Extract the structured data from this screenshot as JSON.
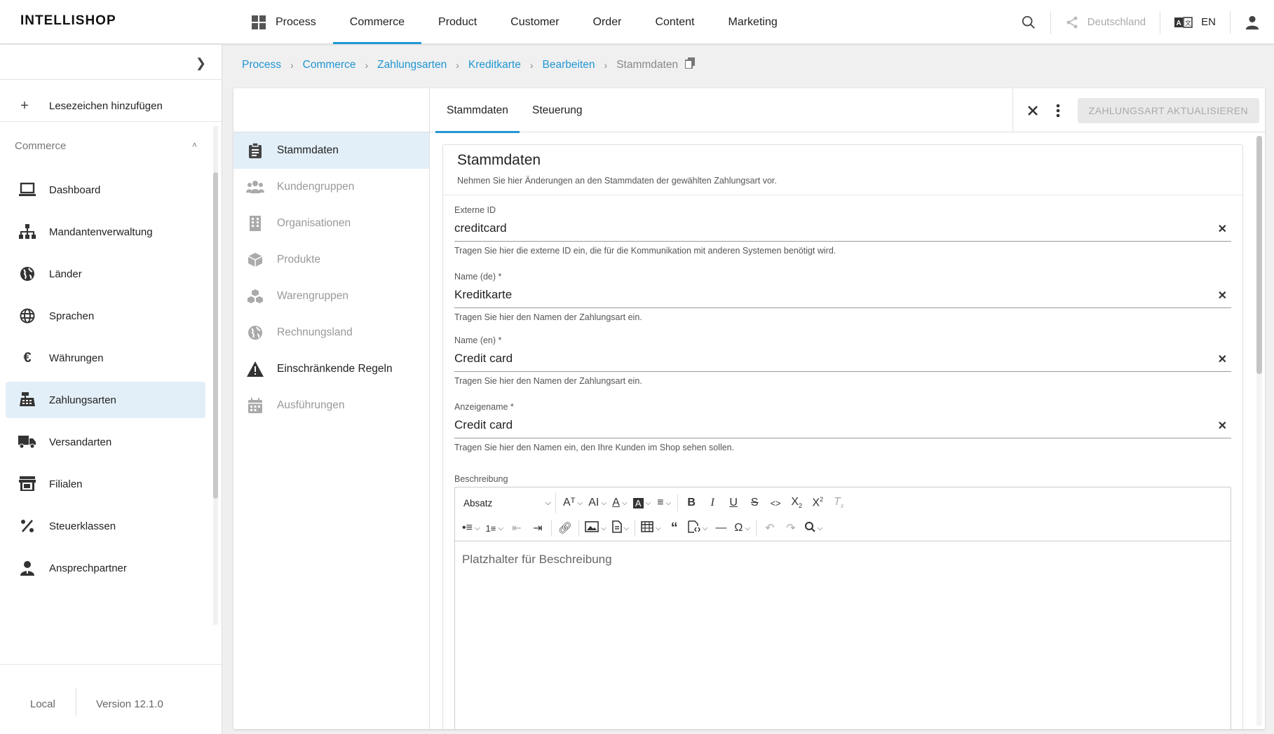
{
  "app": {
    "logo": "INTELLISHOP"
  },
  "topnav": {
    "items": [
      "Process",
      "Commerce",
      "Product",
      "Customer",
      "Order",
      "Content",
      "Marketing"
    ],
    "active": "Commerce",
    "country": "Deutschland",
    "language": "EN"
  },
  "sidebar": {
    "bookmark_label": "Lesezeichen hinzufügen",
    "section": "Commerce",
    "items": [
      {
        "label": "Dashboard",
        "icon": "laptop-icon"
      },
      {
        "label": "Mandantenverwaltung",
        "icon": "hierarchy-icon"
      },
      {
        "label": "Länder",
        "icon": "globe-icon"
      },
      {
        "label": "Sprachen",
        "icon": "language-globe-icon"
      },
      {
        "label": "Währungen",
        "icon": "euro-icon"
      },
      {
        "label": "Zahlungsarten",
        "icon": "cash-register-icon",
        "active": true
      },
      {
        "label": "Versandarten",
        "icon": "truck-icon"
      },
      {
        "label": "Filialen",
        "icon": "store-icon"
      },
      {
        "label": "Steuerklassen",
        "icon": "percent-icon"
      },
      {
        "label": "Ansprechpartner",
        "icon": "person-icon"
      }
    ],
    "footer": {
      "env": "Local",
      "version": "Version 12.1.0"
    }
  },
  "breadcrumb": {
    "items": [
      "Process",
      "Commerce",
      "Zahlungsarten",
      "Kreditkarte",
      "Bearbeiten"
    ],
    "current": "Stammdaten"
  },
  "left_nav": {
    "items": [
      {
        "label": "Stammdaten",
        "icon": "clipboard-icon",
        "state": "active"
      },
      {
        "label": "Kundengruppen",
        "icon": "users-icon",
        "state": "disabled"
      },
      {
        "label": "Organisationen",
        "icon": "building-icon",
        "state": "disabled"
      },
      {
        "label": "Produkte",
        "icon": "box-icon",
        "state": "disabled"
      },
      {
        "label": "Warengruppen",
        "icon": "boxes-icon",
        "state": "disabled"
      },
      {
        "label": "Rechnungsland",
        "icon": "globe-icon",
        "state": "disabled"
      },
      {
        "label": "Einschränkende Regeln",
        "icon": "warning-icon",
        "state": "normal"
      },
      {
        "label": "Ausführungen",
        "icon": "calendar-icon",
        "state": "disabled"
      }
    ]
  },
  "tabs": {
    "items": [
      "Stammdaten",
      "Steuerung"
    ],
    "active": "Stammdaten"
  },
  "actions": {
    "update_button": "ZAHLUNGSART AKTUALISIEREN"
  },
  "form": {
    "title": "Stammdaten",
    "description": "Nehmen Sie hier Änderungen an den Stammdaten der gewählten Zahlungsart vor.",
    "fields": [
      {
        "label": "Externe ID",
        "value": "creditcard",
        "hint": "Tragen Sie hier die externe ID ein, die für die Kommunikation mit anderen Systemen benötigt wird."
      },
      {
        "label": "Name (de) *",
        "value": "Kreditkarte",
        "hint": "Tragen Sie hier den Namen der Zahlungsart ein."
      },
      {
        "label": "Name (en) *",
        "value": "Credit card",
        "hint": "Tragen Sie hier den Namen der Zahlungsart ein."
      },
      {
        "label": "Anzeigename *",
        "value": "Credit card",
        "hint": "Tragen Sie hier den Namen ein, den Ihre Kunden im Shop sehen sollen."
      }
    ],
    "editor": {
      "label": "Beschreibung",
      "paragraph_style": "Absatz",
      "placeholder": "Platzhalter für Beschreibung"
    }
  },
  "colors": {
    "accent": "#2196d3",
    "active_bg": "#e3eff8"
  }
}
